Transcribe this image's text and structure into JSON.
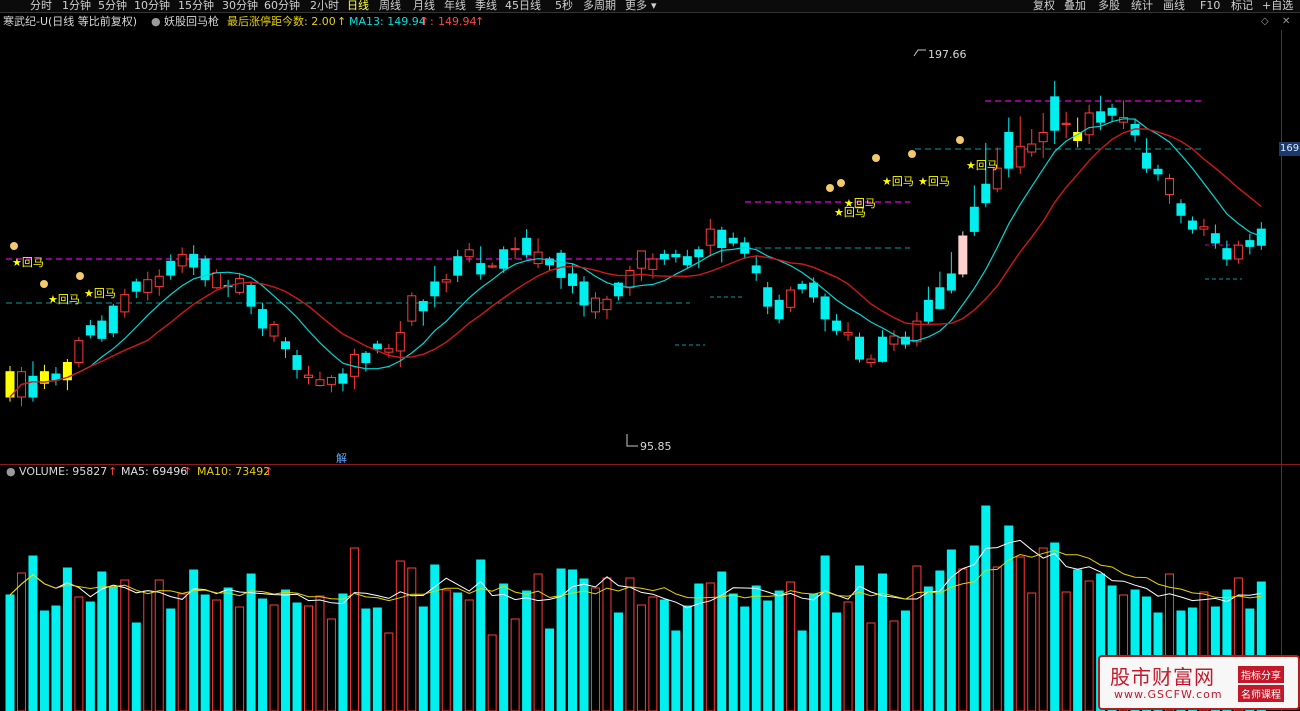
{
  "toolbar": {
    "tabs": [
      "分时",
      "1分钟",
      "5分钟",
      "10分钟",
      "15分钟",
      "30分钟",
      "60分钟",
      "2小时",
      "日线",
      "周线",
      "月线",
      "年线",
      "季线",
      "45日线",
      "5秒",
      "多周期",
      "更多"
    ],
    "active_tab": "日线",
    "right_buttons": [
      "复权",
      "叠加",
      "多股",
      "统计",
      "画线",
      "F10",
      "标记",
      "+自选"
    ]
  },
  "info": {
    "title": "寒武纪-U(日线 等比前复权)",
    "indicator": "妖股回马枪",
    "limit_label": "最后涨停距今数: 2.00",
    "ma13_label": "MA13: 149.94",
    "ma13_value2": "149.94"
  },
  "chart": {
    "high_label": "197.66",
    "low_label": "95.85",
    "unlock_label": "解",
    "price_badge": "169",
    "signal_label": "★回马",
    "colors": {
      "up": "#ff3a3a",
      "down": "#00f0f0",
      "signal": "#ffff00",
      "ma13": "#d01818",
      "ma_cyan": "#00d6d6",
      "magenta": "#c000c0",
      "cyan_dash": "#00a0a0"
    }
  },
  "volume": {
    "label": "VOLUME: 95827",
    "ma5_label": "MA5: 69496",
    "ma10_label": "MA10: 73492"
  },
  "watermark": {
    "title": "股市财富网",
    "url": "www.GSCFW.com",
    "tag1": "指标分享",
    "tag2": "名师课程"
  },
  "chart_data": {
    "type": "candlestick",
    "candles": [
      [
        0,
        0.62,
        0.4,
        0.67,
        0.36,
        "s"
      ],
      [
        1,
        0.4,
        0.62,
        0.66,
        0.32,
        "u"
      ],
      [
        2,
        0.4,
        0.58,
        0.71,
        0.36,
        "d"
      ],
      [
        3,
        0.62,
        0.52,
        0.68,
        0.47,
        "s"
      ],
      [
        4,
        0.55,
        0.6,
        0.66,
        0.5,
        "d"
      ],
      [
        5,
        0.55,
        0.7,
        0.73,
        0.46,
        "s"
      ],
      [
        6,
        0.7,
        0.89,
        0.92,
        0.66,
        "u"
      ],
      [
        7,
        0.94,
        1.02,
        1.07,
        0.91,
        "d"
      ],
      [
        8,
        0.91,
        1.06,
        1.11,
        0.88,
        "d"
      ],
      [
        9,
        0.96,
        1.19,
        1.21,
        0.92,
        "d"
      ],
      [
        10,
        1.14,
        1.29,
        1.34,
        1.09,
        "u"
      ],
      [
        11,
        1.4,
        1.32,
        1.43,
        1.26,
        "d"
      ],
      [
        12,
        1.31,
        1.42,
        1.49,
        1.24,
        "u"
      ],
      [
        13,
        1.36,
        1.45,
        1.51,
        1.28,
        "u"
      ],
      [
        14,
        1.46,
        1.58,
        1.64,
        1.42,
        "d"
      ],
      [
        15,
        1.54,
        1.64,
        1.7,
        1.48,
        "u"
      ],
      [
        16,
        1.64,
        1.53,
        1.72,
        1.46,
        "d"
      ],
      [
        17,
        1.6,
        1.42,
        1.63,
        1.36,
        "d"
      ],
      [
        18,
        1.35,
        1.48,
        1.51,
        1.34,
        "u"
      ],
      [
        19,
        1.37,
        1.36,
        1.42,
        1.27,
        "d"
      ],
      [
        20,
        1.43,
        1.31,
        1.48,
        1.29,
        "u"
      ],
      [
        21,
        1.37,
        1.19,
        1.4,
        1.12,
        "d"
      ],
      [
        22,
        1.16,
        1.0,
        1.22,
        0.93,
        "d"
      ],
      [
        23,
        1.03,
        0.93,
        1.06,
        0.88,
        "u"
      ],
      [
        24,
        0.88,
        0.82,
        0.92,
        0.74,
        "d"
      ],
      [
        25,
        0.76,
        0.64,
        0.81,
        0.56,
        "d"
      ],
      [
        26,
        0.59,
        0.57,
        0.67,
        0.51,
        "u"
      ],
      [
        27,
        0.55,
        0.5,
        0.62,
        0.49,
        "u"
      ],
      [
        28,
        0.51,
        0.57,
        0.59,
        0.44,
        "u"
      ],
      [
        29,
        0.6,
        0.52,
        0.65,
        0.45,
        "d"
      ],
      [
        30,
        0.58,
        0.77,
        0.82,
        0.47,
        "u"
      ],
      [
        31,
        0.7,
        0.78,
        0.8,
        0.62,
        "d"
      ],
      [
        32,
        0.86,
        0.82,
        0.89,
        0.78,
        "d"
      ],
      [
        33,
        0.82,
        0.79,
        0.86,
        0.74,
        "u"
      ],
      [
        34,
        0.8,
        0.96,
        1.06,
        0.66,
        "u"
      ],
      [
        35,
        1.28,
        1.06,
        1.31,
        1.02,
        "u"
      ],
      [
        36,
        1.15,
        1.23,
        1.25,
        1.02,
        "d"
      ],
      [
        37,
        1.28,
        1.4,
        1.54,
        1.18,
        "d"
      ],
      [
        38,
        1.4,
        1.42,
        1.47,
        1.31,
        "u"
      ],
      [
        39,
        1.46,
        1.62,
        1.68,
        1.4,
        "d"
      ],
      [
        40,
        1.68,
        1.62,
        1.74,
        1.57,
        "u"
      ],
      [
        41,
        1.56,
        1.47,
        1.71,
        1.42,
        "d"
      ],
      [
        42,
        1.53,
        1.54,
        1.57,
        1.52,
        "u"
      ],
      [
        43,
        1.52,
        1.68,
        1.71,
        1.48,
        "d"
      ],
      [
        44,
        1.69,
        1.69,
        1.79,
        1.6,
        "u"
      ],
      [
        45,
        1.78,
        1.64,
        1.86,
        1.61,
        "d"
      ],
      [
        46,
        1.66,
        1.56,
        1.78,
        1.52,
        "u"
      ],
      [
        47,
        1.6,
        1.55,
        1.62,
        1.5,
        "d"
      ],
      [
        48,
        1.65,
        1.44,
        1.68,
        1.34,
        "d"
      ],
      [
        49,
        1.47,
        1.37,
        1.56,
        1.3,
        "d"
      ],
      [
        50,
        1.4,
        1.2,
        1.45,
        1.1,
        "d"
      ],
      [
        51,
        1.26,
        1.14,
        1.31,
        1.08,
        "u"
      ],
      [
        52,
        1.16,
        1.25,
        1.28,
        1.08,
        "u"
      ],
      [
        53,
        1.28,
        1.39,
        1.4,
        1.24,
        "d"
      ],
      [
        54,
        1.35,
        1.5,
        1.54,
        1.28,
        "u"
      ],
      [
        55,
        1.52,
        1.67,
        1.67,
        1.41,
        "u"
      ],
      [
        56,
        1.6,
        1.51,
        1.65,
        1.43,
        "u"
      ],
      [
        57,
        1.6,
        1.64,
        1.68,
        1.55,
        "d"
      ],
      [
        58,
        1.62,
        1.64,
        1.68,
        1.57,
        "d"
      ],
      [
        59,
        1.62,
        1.55,
        1.68,
        1.52,
        "d"
      ],
      [
        60,
        1.62,
        1.68,
        1.71,
        1.52,
        "d"
      ],
      [
        61,
        1.72,
        1.86,
        1.95,
        1.62,
        "u"
      ],
      [
        62,
        1.7,
        1.85,
        1.88,
        1.57,
        "d"
      ],
      [
        63,
        1.78,
        1.74,
        1.83,
        1.71,
        "d"
      ],
      [
        64,
        1.74,
        1.65,
        1.79,
        1.6,
        "d"
      ],
      [
        65,
        1.54,
        1.48,
        1.63,
        1.41,
        "d"
      ],
      [
        66,
        1.35,
        1.19,
        1.4,
        1.12,
        "d"
      ],
      [
        67,
        1.08,
        1.24,
        1.29,
        1.04,
        "d"
      ],
      [
        68,
        1.18,
        1.33,
        1.36,
        1.14,
        "u"
      ],
      [
        69,
        1.34,
        1.38,
        1.41,
        1.3,
        "d"
      ],
      [
        70,
        1.39,
        1.27,
        1.44,
        1.22,
        "d"
      ],
      [
        71,
        1.27,
        1.08,
        1.3,
        0.97,
        "d"
      ],
      [
        72,
        1.06,
        0.98,
        1.12,
        0.94,
        "d"
      ],
      [
        73,
        0.96,
        0.94,
        1.05,
        0.89,
        "u"
      ],
      [
        74,
        0.92,
        0.73,
        0.96,
        0.7,
        "d"
      ],
      [
        75,
        0.73,
        0.7,
        0.77,
        0.66,
        "u"
      ],
      [
        76,
        0.71,
        0.92,
        0.98,
        0.7,
        "d"
      ],
      [
        77,
        0.86,
        0.93,
        0.98,
        0.8,
        "u"
      ],
      [
        78,
        0.92,
        0.86,
        0.97,
        0.82,
        "d"
      ],
      [
        79,
        0.88,
        1.06,
        1.14,
        0.84,
        "u"
      ],
      [
        80,
        1.06,
        1.24,
        1.36,
        1.03,
        "d"
      ],
      [
        81,
        1.17,
        1.35,
        1.49,
        1.16,
        "d"
      ],
      [
        82,
        1.33,
        1.47,
        1.66,
        1.3,
        "d"
      ],
      [
        83,
        1.47,
        1.8,
        1.84,
        1.44,
        "w"
      ],
      [
        84,
        1.84,
        2.05,
        2.24,
        1.8,
        "d"
      ],
      [
        85,
        2.09,
        2.25,
        2.61,
        2.05,
        "d"
      ],
      [
        86,
        2.21,
        2.39,
        2.57,
        2.18,
        "u"
      ],
      [
        87,
        2.39,
        2.7,
        2.83,
        2.31,
        "d"
      ],
      [
        88,
        2.4,
        2.58,
        2.84,
        2.34,
        "u"
      ],
      [
        89,
        2.53,
        2.6,
        2.73,
        2.49,
        "u"
      ],
      [
        90,
        2.62,
        2.7,
        2.87,
        2.48,
        "u"
      ],
      [
        91,
        2.72,
        3.01,
        3.15,
        2.6,
        "d"
      ],
      [
        92,
        2.77,
        2.78,
        2.88,
        2.65,
        "u"
      ],
      [
        93,
        2.63,
        2.7,
        2.83,
        2.57,
        "s"
      ],
      [
        94,
        2.68,
        2.87,
        2.94,
        2.6,
        "u"
      ],
      [
        95,
        2.88,
        2.79,
        3.02,
        2.72,
        "d"
      ],
      [
        96,
        2.85,
        2.91,
        2.95,
        2.79,
        "d"
      ],
      [
        97,
        2.83,
        2.79,
        2.98,
        2.73,
        "u"
      ],
      [
        98,
        2.77,
        2.68,
        2.82,
        2.62,
        "d"
      ],
      [
        99,
        2.52,
        2.39,
        2.65,
        2.35,
        "d"
      ],
      [
        100,
        2.38,
        2.34,
        2.42,
        2.28,
        "d"
      ],
      [
        101,
        2.3,
        2.16,
        2.34,
        2.08,
        "u"
      ],
      [
        102,
        2.08,
        1.98,
        2.12,
        1.91,
        "d"
      ],
      [
        103,
        1.93,
        1.86,
        1.97,
        1.82,
        "d"
      ],
      [
        104,
        1.88,
        1.86,
        1.95,
        1.8,
        "u"
      ],
      [
        105,
        1.82,
        1.74,
        1.9,
        1.69,
        "d"
      ],
      [
        106,
        1.69,
        1.6,
        1.76,
        1.54,
        "d"
      ],
      [
        107,
        1.6,
        1.72,
        1.76,
        1.56,
        "u"
      ],
      [
        108,
        1.71,
        1.76,
        1.82,
        1.64,
        "d"
      ],
      [
        109,
        1.72,
        1.86,
        1.92,
        1.68,
        "d"
      ]
    ]
  }
}
